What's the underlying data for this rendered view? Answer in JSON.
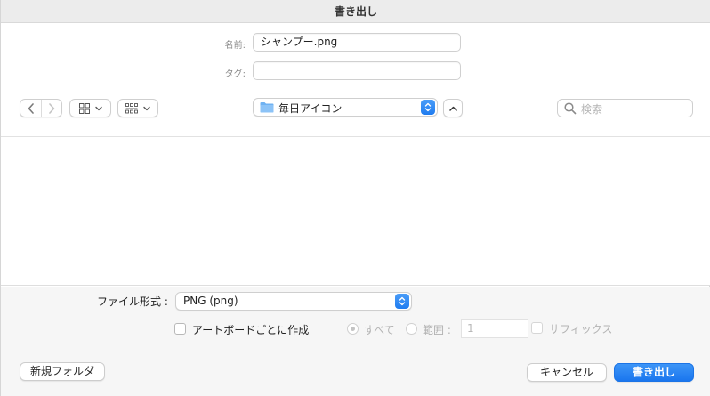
{
  "window": {
    "title": "書き出し"
  },
  "save": {
    "name_label": "名前:",
    "name_value": "シャンプー.png",
    "tags_label": "タグ:",
    "tags_value": ""
  },
  "toolbar": {
    "back_icon": "chevron-left-icon",
    "forward_icon": "chevron-right-icon",
    "icon_view_icon": "grid-icon",
    "group_view_icon": "group-grid-icon",
    "location": "毎日アイコン",
    "search_placeholder": "検索"
  },
  "options": {
    "format_label": "ファイル形式 :",
    "format_value": "PNG (png)",
    "per_artboard_label": "アートボードごとに作成",
    "all_label": "すべて",
    "range_label": "範囲 :",
    "range_value": "1",
    "suffix_label": "サフィックス"
  },
  "buttons": {
    "new_folder": "新規フォルダ",
    "cancel": "キャンセル",
    "export": "書き出し"
  },
  "colors": {
    "accent": "#1a76ee"
  }
}
